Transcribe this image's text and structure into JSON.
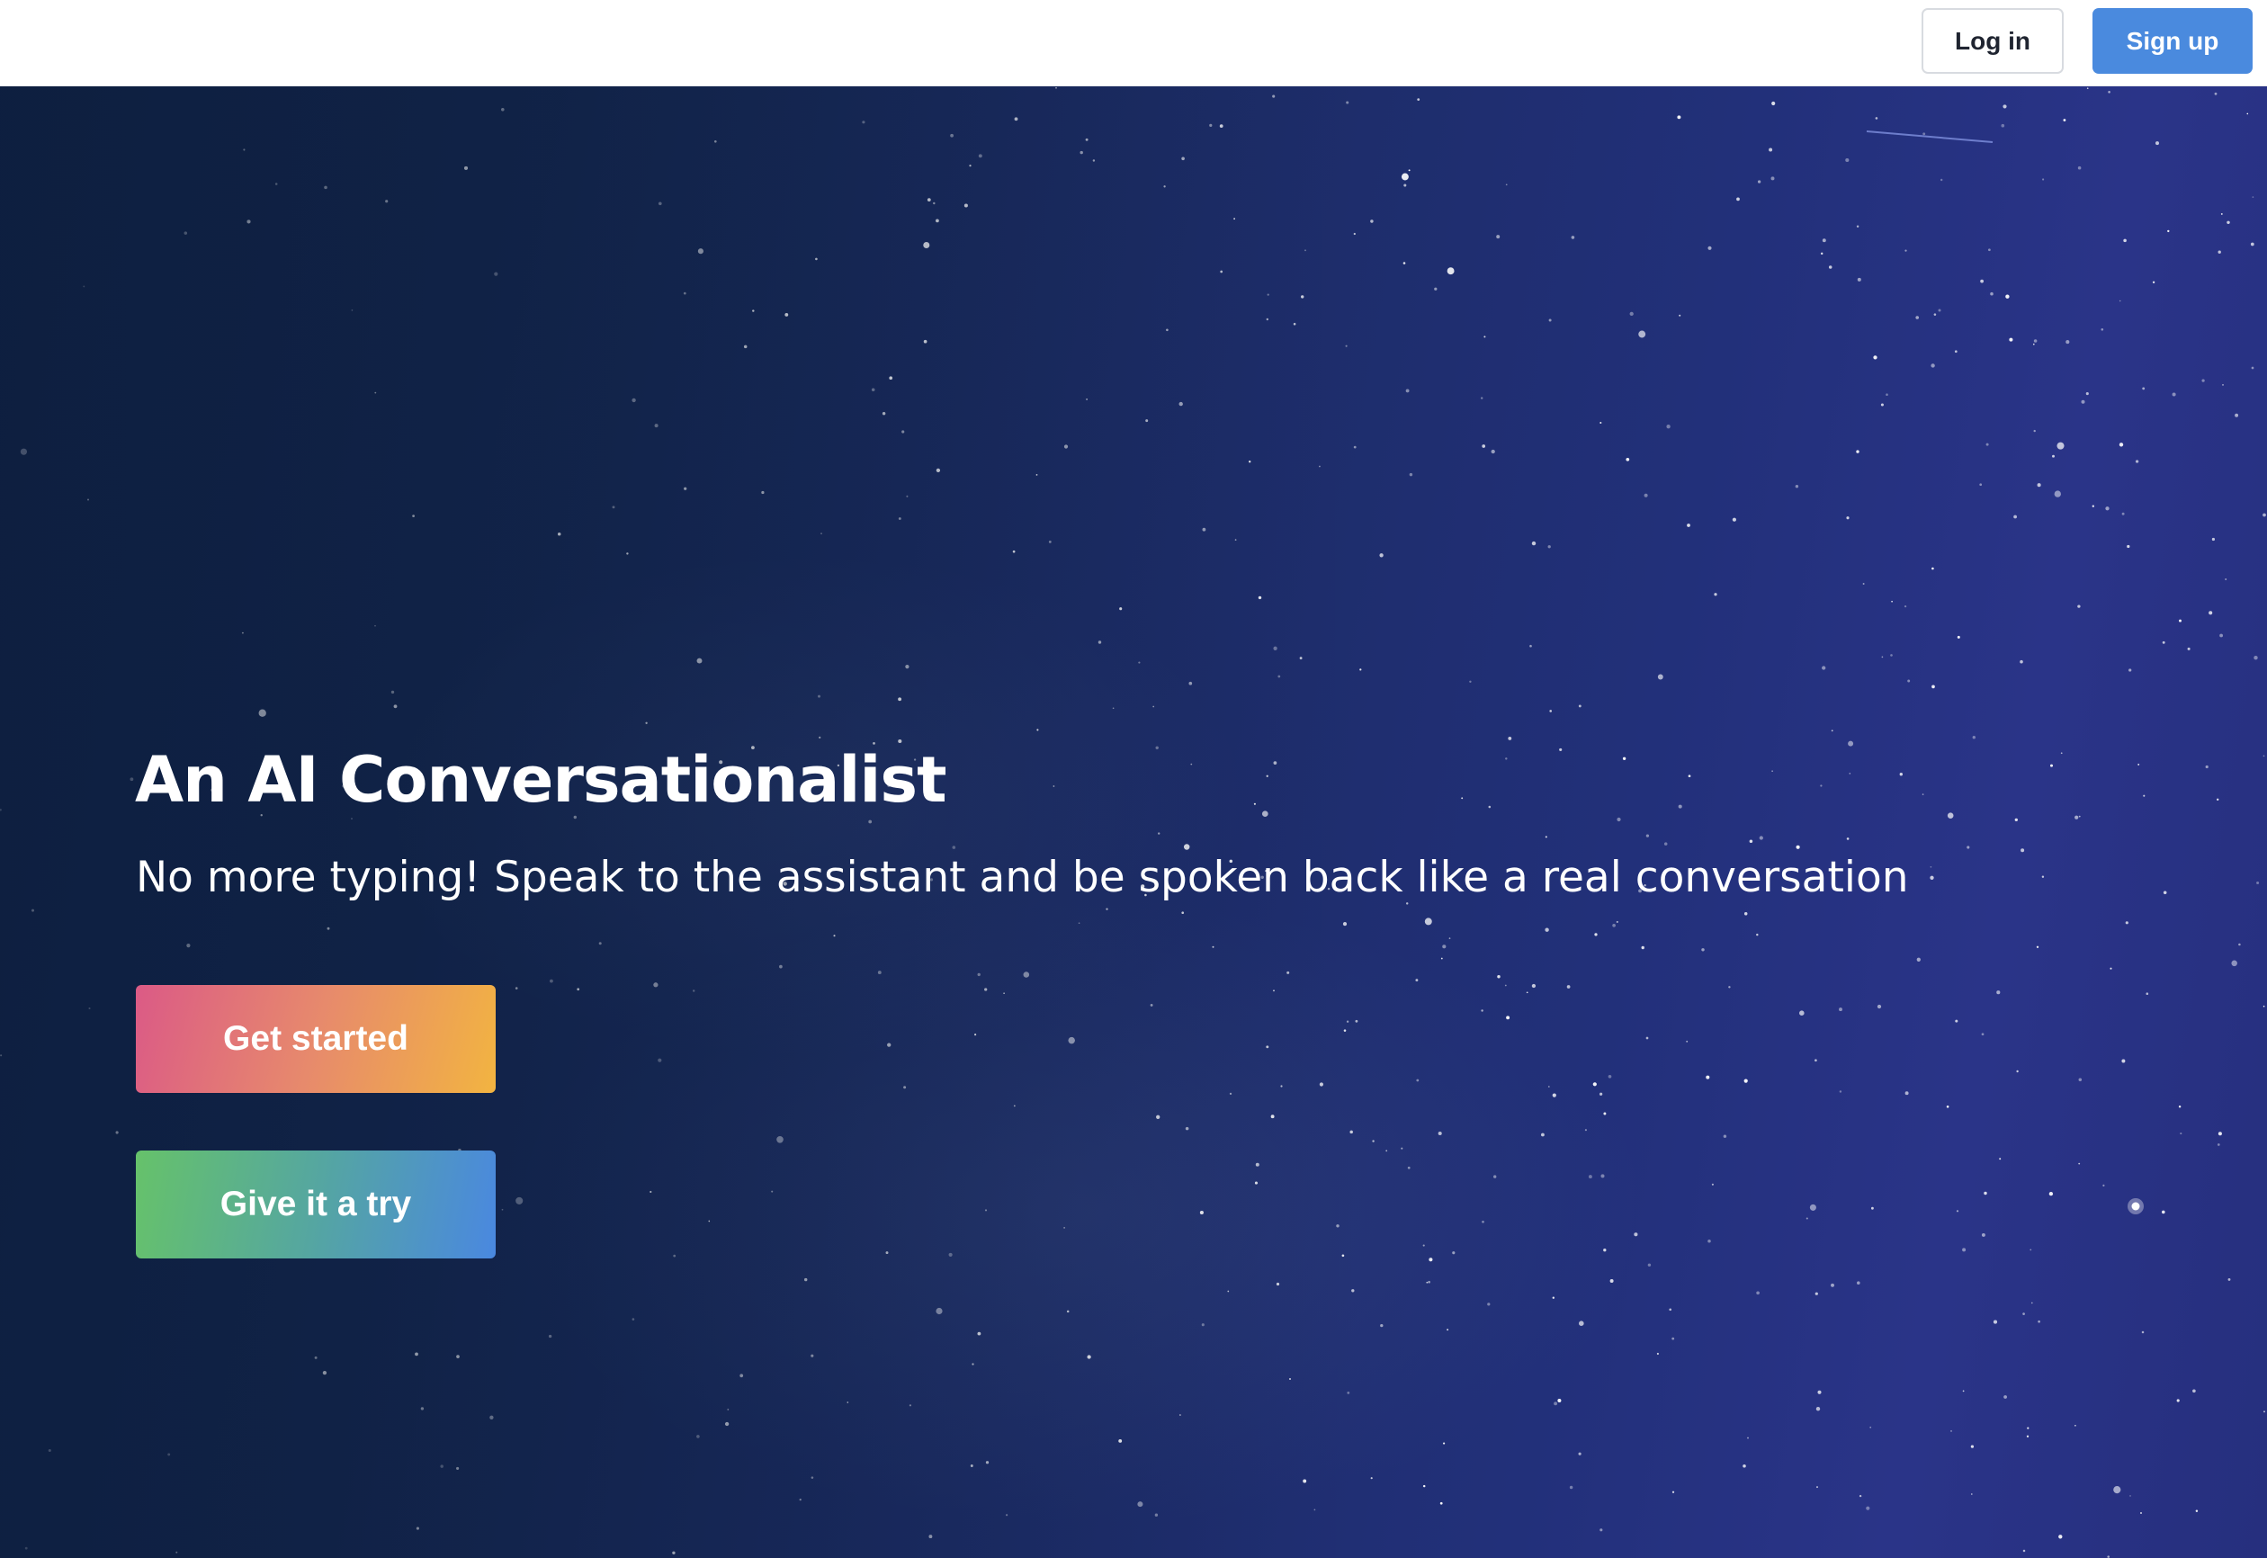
{
  "header": {
    "login_label": "Log in",
    "signup_label": "Sign up"
  },
  "hero": {
    "title": "An AI Conversationalist",
    "subtitle": "No more typing! Speak to the assistant and be spoken back like a real conversation",
    "primary_cta_label": "Get started",
    "secondary_cta_label": "Give it a try",
    "background": "starry night sky"
  },
  "colors": {
    "signup_button": "#4a8ade",
    "hero_background": "#1c2c66",
    "primary_cta_gradient": [
      "#db5a86",
      "#f2b441"
    ],
    "secondary_cta_gradient": [
      "#66c26a",
      "#4a88e0"
    ]
  }
}
